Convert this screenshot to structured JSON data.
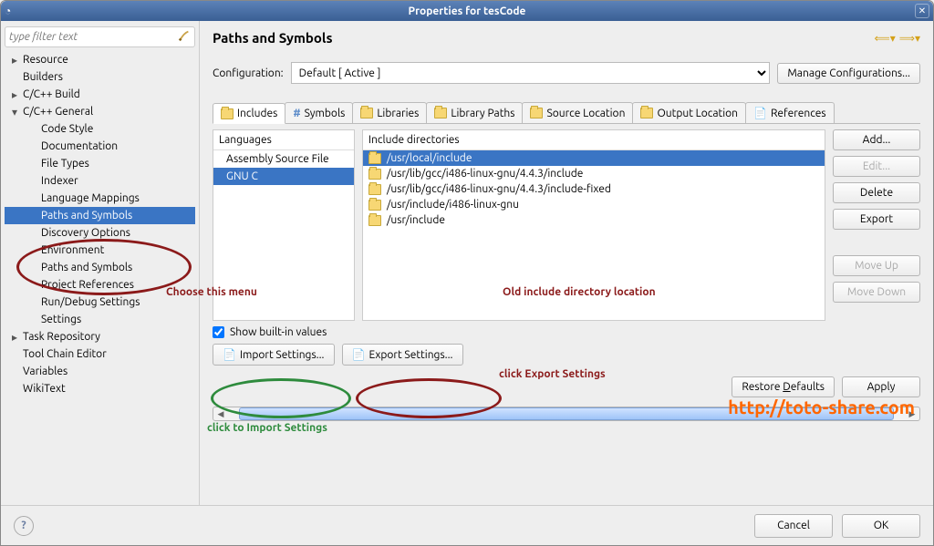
{
  "window": {
    "title": "Properties for tesCode"
  },
  "sidebar": {
    "filter_placeholder": "type filter text",
    "items": [
      {
        "label": "Resource",
        "level": "top",
        "arrow": "▸"
      },
      {
        "label": "Builders",
        "level": "top",
        "arrow": ""
      },
      {
        "label": "C/C++ Build",
        "level": "top",
        "arrow": "▸"
      },
      {
        "label": "C/C++ General",
        "level": "top",
        "arrow": "▾"
      },
      {
        "label": "Code Style",
        "level": "sub",
        "arrow": ""
      },
      {
        "label": "Documentation",
        "level": "sub",
        "arrow": ""
      },
      {
        "label": "File Types",
        "level": "sub",
        "arrow": ""
      },
      {
        "label": "Indexer",
        "level": "sub",
        "arrow": ""
      },
      {
        "label": "Language Mappings",
        "level": "sub",
        "arrow": ""
      },
      {
        "label": "Paths and Symbols",
        "level": "sub",
        "arrow": "",
        "selected": true
      },
      {
        "label": "Discovery Options",
        "level": "sub",
        "arrow": ""
      },
      {
        "label": "Environment",
        "level": "sub",
        "arrow": ""
      },
      {
        "label": "Paths and Symbols",
        "level": "sub",
        "arrow": ""
      },
      {
        "label": "Project References",
        "level": "sub",
        "arrow": ""
      },
      {
        "label": "Run/Debug Settings",
        "level": "sub",
        "arrow": ""
      },
      {
        "label": "Settings",
        "level": "sub",
        "arrow": ""
      },
      {
        "label": "Task Repository",
        "level": "top",
        "arrow": "▸"
      },
      {
        "label": "Tool Chain Editor",
        "level": "top",
        "arrow": ""
      },
      {
        "label": "Variables",
        "level": "top",
        "arrow": ""
      },
      {
        "label": "WikiText",
        "level": "top",
        "arrow": ""
      }
    ]
  },
  "page": {
    "heading": "Paths and Symbols",
    "config_label": "Configuration:",
    "config_value": "Default  [ Active ]",
    "manage_btn": "Manage Configurations...",
    "tabs": [
      {
        "label": "Includes",
        "active": true,
        "icon": "folder"
      },
      {
        "label": "Symbols",
        "active": false,
        "icon": "hash"
      },
      {
        "label": "Libraries",
        "active": false,
        "icon": "folder"
      },
      {
        "label": "Library Paths",
        "active": false,
        "icon": "folder"
      },
      {
        "label": "Source Location",
        "active": false,
        "icon": "folder"
      },
      {
        "label": "Output Location",
        "active": false,
        "icon": "folder"
      },
      {
        "label": "References",
        "active": false,
        "icon": "file"
      }
    ],
    "lang_head": "Languages",
    "langs": [
      {
        "label": "Assembly Source File",
        "selected": false
      },
      {
        "label": "GNU C",
        "selected": true
      }
    ],
    "inc_head": "Include directories",
    "includes": [
      {
        "path": "/usr/local/include",
        "selected": true
      },
      {
        "path": "/usr/lib/gcc/i486-linux-gnu/4.4.3/include",
        "selected": false
      },
      {
        "path": "/usr/lib/gcc/i486-linux-gnu/4.4.3/include-fixed",
        "selected": false
      },
      {
        "path": "/usr/include/i486-linux-gnu",
        "selected": false
      },
      {
        "path": "/usr/include",
        "selected": false
      }
    ],
    "side_btns": {
      "add": "Add...",
      "edit": "Edit...",
      "delete": "Delete",
      "export": "Export",
      "moveup": "Move Up",
      "movedown": "Move Down"
    },
    "show_builtin": "Show built-in values",
    "import_btn": "Import Settings...",
    "export_btn": "Export Settings...",
    "restore_btn": "Restore Defaults",
    "apply_btn": "Apply"
  },
  "bottom": {
    "cancel": "Cancel",
    "ok": "OK"
  },
  "annotations": {
    "choose_menu": "Choose this menu",
    "old_include": "Old include directory location",
    "click_export": "click Export Settings",
    "click_import": "click to Import Settings",
    "url": "http://toto-share.com"
  }
}
